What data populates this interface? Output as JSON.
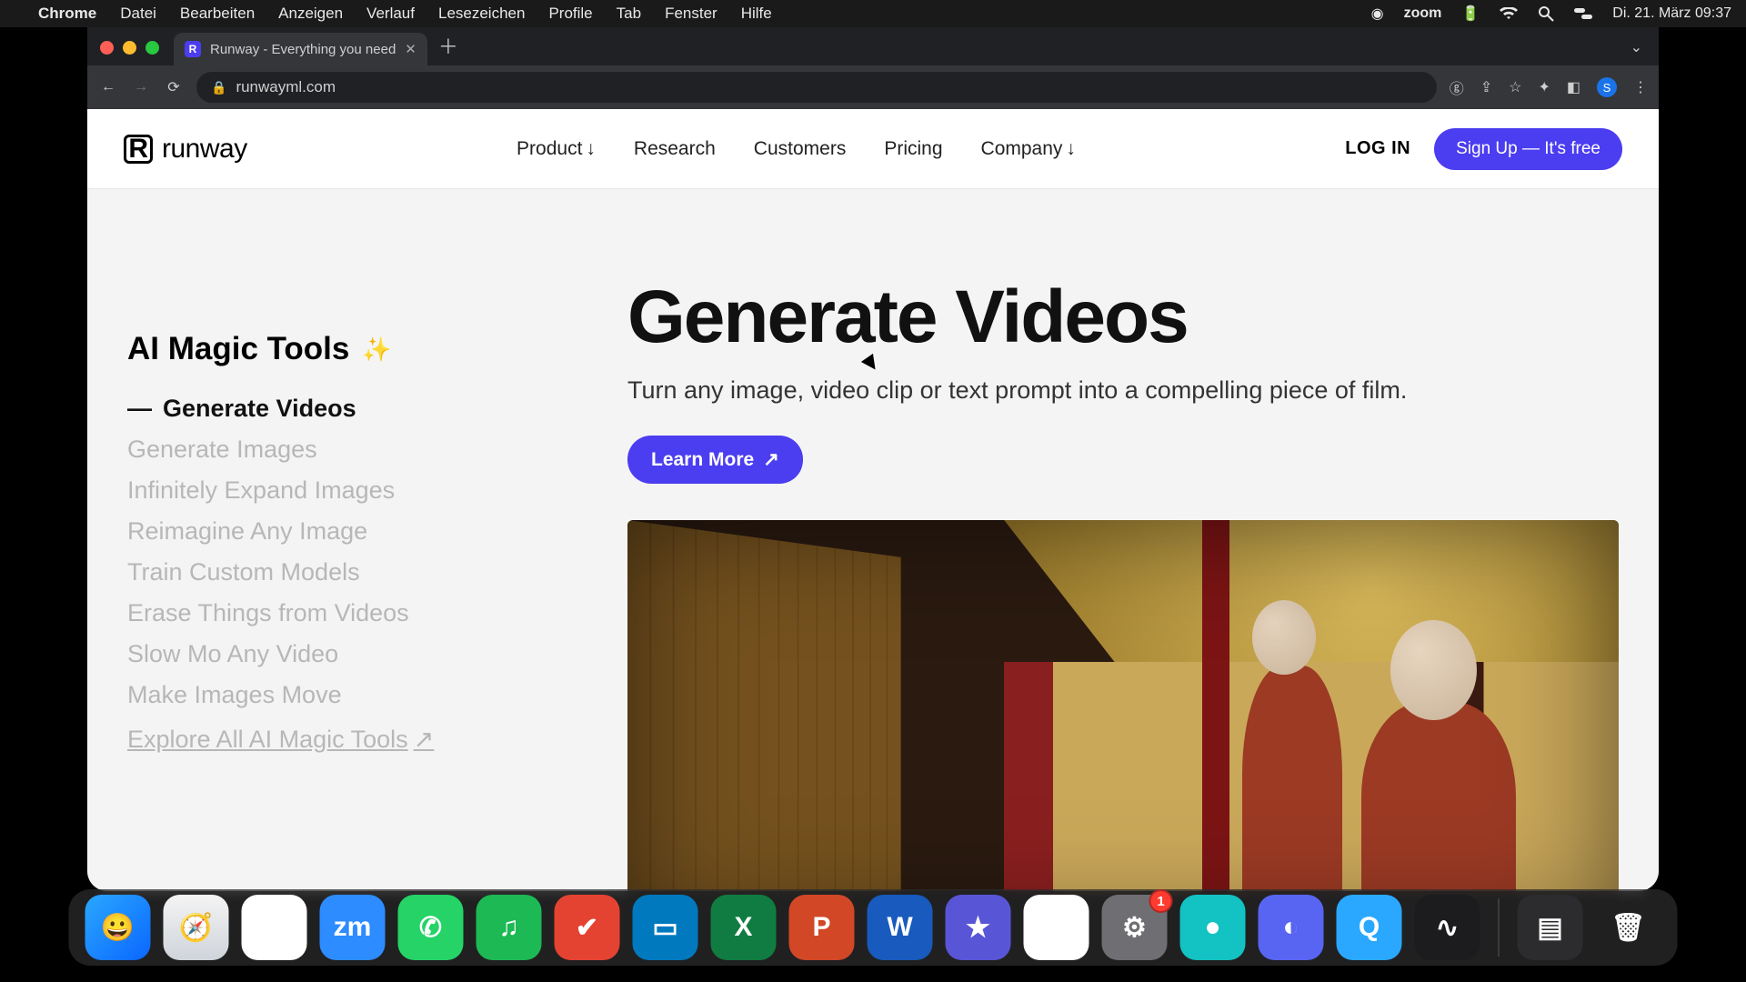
{
  "menubar": {
    "app": "Chrome",
    "items": [
      "Datei",
      "Bearbeiten",
      "Anzeigen",
      "Verlauf",
      "Lesezeichen",
      "Profile",
      "Tab",
      "Fenster",
      "Hilfe"
    ],
    "zoom": "zoom",
    "clock": "Di. 21. März  09:37"
  },
  "browser": {
    "tab_title": "Runway - Everything you need",
    "url": "runwayml.com",
    "avatar_initial": "S"
  },
  "site": {
    "brand": "runway",
    "nav": {
      "product": "Product",
      "research": "Research",
      "customers": "Customers",
      "pricing": "Pricing",
      "company": "Company"
    },
    "login": "LOG IN",
    "signup": "Sign Up — It's free"
  },
  "sidebar": {
    "title": "AI Magic Tools",
    "items": [
      "Generate Videos",
      "Generate Images",
      "Infinitely Expand Images",
      "Reimagine Any Image",
      "Train Custom Models",
      "Erase Things from Videos",
      "Slow Mo Any Video",
      "Make Images Move"
    ],
    "explore": "Explore All AI Magic Tools"
  },
  "hero": {
    "title": "Generate Videos",
    "subtitle": "Turn any image, video clip or text prompt into a compelling piece of film.",
    "cta": "Learn More"
  },
  "dock": {
    "apps": [
      {
        "name": "finder",
        "bg": "linear-gradient(135deg,#2aa8ff,#0a66ff)",
        "glyph": "😀"
      },
      {
        "name": "safari",
        "bg": "linear-gradient(#f4f4f4,#cfd4da)",
        "glyph": "🧭"
      },
      {
        "name": "chrome",
        "bg": "#fff",
        "glyph": "◉"
      },
      {
        "name": "zoom",
        "bg": "#2d8cff",
        "glyph": "zm"
      },
      {
        "name": "whatsapp",
        "bg": "#25d366",
        "glyph": "✆"
      },
      {
        "name": "spotify",
        "bg": "#1db954",
        "glyph": "♫"
      },
      {
        "name": "todoist",
        "bg": "#e44332",
        "glyph": "✔"
      },
      {
        "name": "trello",
        "bg": "#0079bf",
        "glyph": "▭"
      },
      {
        "name": "excel",
        "bg": "#107c41",
        "glyph": "X"
      },
      {
        "name": "powerpoint",
        "bg": "#d24726",
        "glyph": "P"
      },
      {
        "name": "word",
        "bg": "#185abd",
        "glyph": "W"
      },
      {
        "name": "imovie",
        "bg": "#5856d6",
        "glyph": "★"
      },
      {
        "name": "drive",
        "bg": "#fff",
        "glyph": "▲"
      },
      {
        "name": "settings",
        "bg": "#6e6e73",
        "glyph": "⚙",
        "badge": "1"
      },
      {
        "name": "app-teal",
        "bg": "#13c2c2",
        "glyph": "●"
      },
      {
        "name": "discord",
        "bg": "#5865f2",
        "glyph": "◐"
      },
      {
        "name": "quicktime",
        "bg": "#2aa8ff",
        "glyph": "Q"
      },
      {
        "name": "voice-memos",
        "bg": "#1c1c1e",
        "glyph": "∿"
      }
    ],
    "right": [
      {
        "name": "calculator",
        "bg": "#2c2c2e",
        "glyph": "▤"
      },
      {
        "name": "trash",
        "bg": "transparent",
        "glyph": "🗑"
      }
    ]
  }
}
